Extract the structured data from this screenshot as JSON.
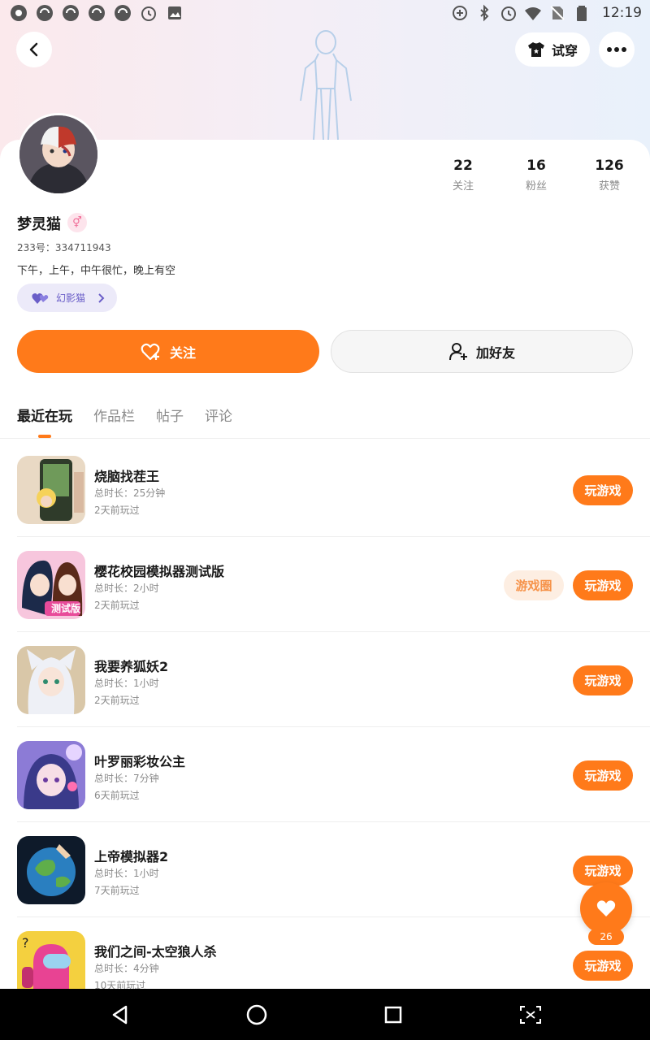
{
  "status_bar": {
    "time": "12:19",
    "left_icons": [
      "app-icon",
      "sync-icon",
      "sync-icon",
      "sync-icon",
      "sync-icon",
      "alarm-icon",
      "image-icon"
    ],
    "right_icons": [
      "data-saver-icon",
      "bluetooth-icon",
      "alarm-icon",
      "wifi-icon",
      "no-sim-icon",
      "battery-icon"
    ]
  },
  "header": {
    "back_icon": "back-icon",
    "tryon_label": "试穿",
    "more_icon": "more-icon"
  },
  "profile": {
    "username": "梦灵猫",
    "gender_symbol": "⚥",
    "uid": "233号：334711943",
    "bio": "下午，上午，中午很忙，晚上有空",
    "tag_label": "幻影猫"
  },
  "stats": [
    {
      "value": "22",
      "label": "关注"
    },
    {
      "value": "16",
      "label": "粉丝"
    },
    {
      "value": "126",
      "label": "获赞"
    }
  ],
  "actions": {
    "follow_label": "关注",
    "add_friend_label": "加好友"
  },
  "tabs": [
    {
      "label": "最近在玩",
      "active": true
    },
    {
      "label": "作品栏",
      "active": false
    },
    {
      "label": "帖子",
      "active": false
    },
    {
      "label": "评论",
      "active": false
    }
  ],
  "games": [
    {
      "title": "烧脑找茬王",
      "duration": "总时长：25分钟",
      "last_played": "2天前玩过",
      "play_label": "玩游戏"
    },
    {
      "title": "樱花校园模拟器测试版",
      "duration": "总时长：2小时",
      "last_played": "2天前玩过",
      "play_label": "玩游戏",
      "circle_label": "游戏圈",
      "icon_badge": "测试版"
    },
    {
      "title": "我要养狐妖2",
      "duration": "总时长：1小时",
      "last_played": "2天前玩过",
      "play_label": "玩游戏"
    },
    {
      "title": "叶罗丽彩妆公主",
      "duration": "总时长：7分钟",
      "last_played": "6天前玩过",
      "play_label": "玩游戏"
    },
    {
      "title": "上帝模拟器2",
      "duration": "总时长：1小时",
      "last_played": "7天前玩过",
      "play_label": "玩游戏"
    },
    {
      "title": "我们之间-太空狼人杀",
      "duration": "总时长：4分钟",
      "last_played": "10天前玩过",
      "play_label": "玩游戏"
    }
  ],
  "like_fab": {
    "count": "26",
    "icon": "heart-icon"
  },
  "colors": {
    "accent": "#ff7a1a",
    "tag": "#6a5ec8"
  }
}
